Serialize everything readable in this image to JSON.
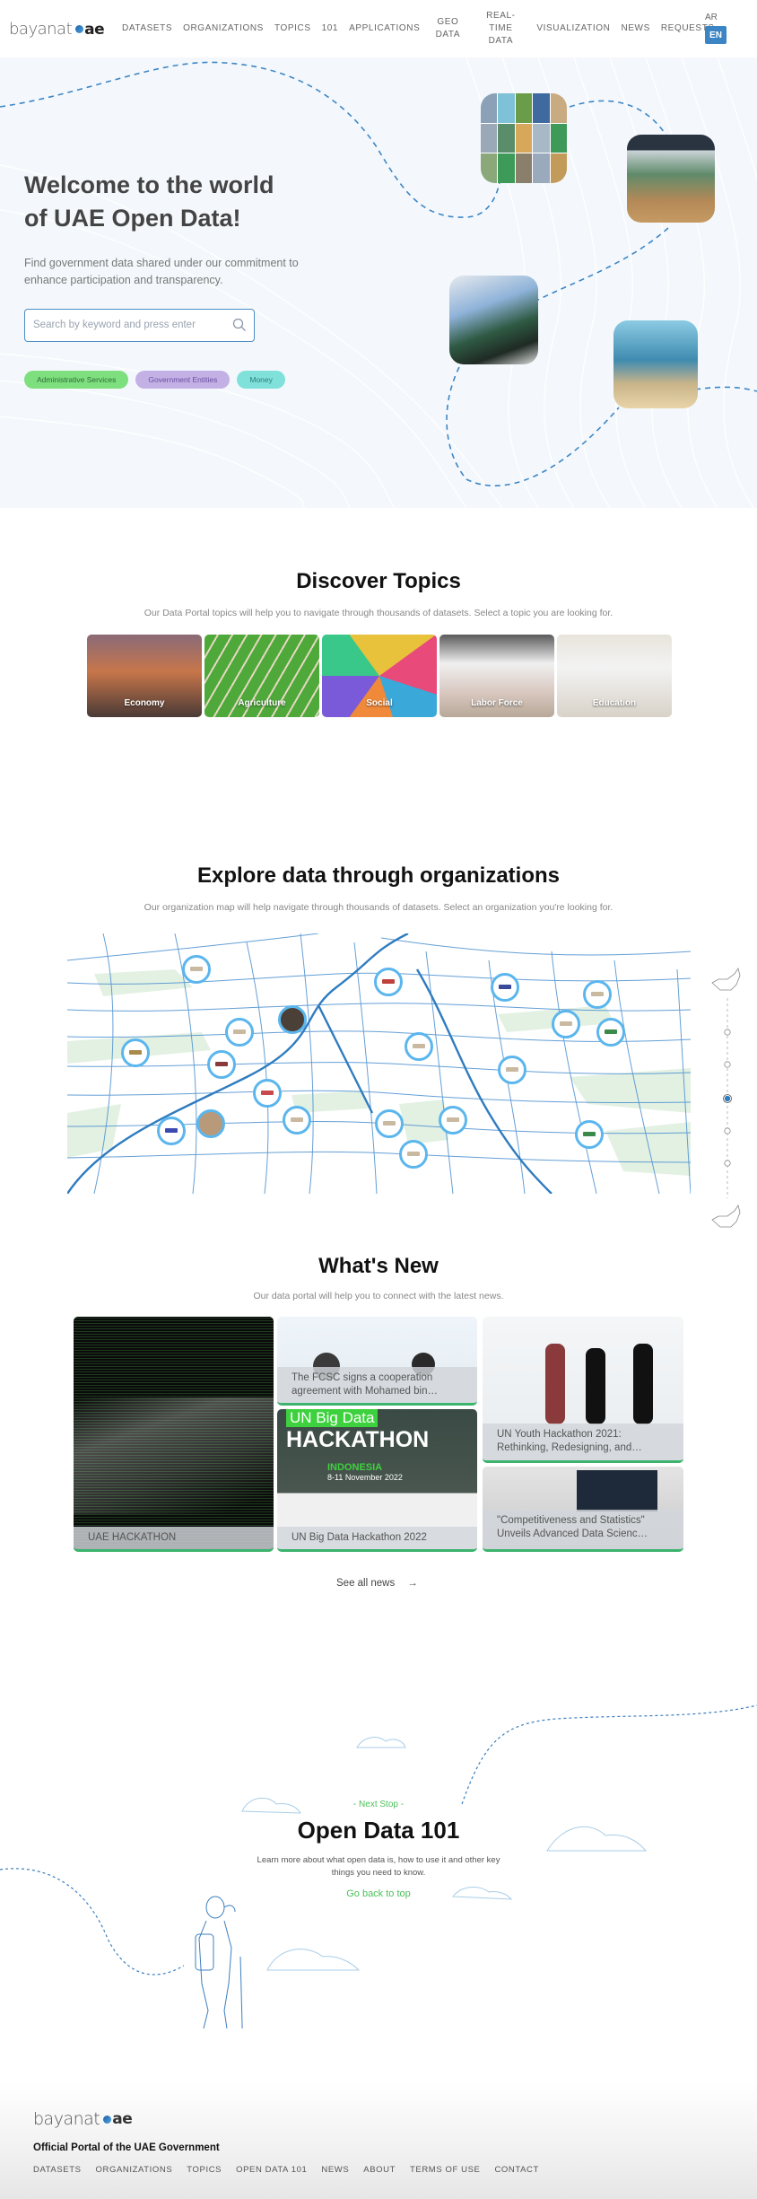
{
  "header": {
    "logo_text": "bayanat",
    "logo_suffix": "ae",
    "nav": [
      {
        "label": "DATASETS"
      },
      {
        "label": "ORGANIZATIONS"
      },
      {
        "label": "TOPICS"
      },
      {
        "label": "101"
      },
      {
        "label": "APPLICATIONS"
      },
      {
        "label": "GEO DATA"
      },
      {
        "label": "REAL-TIME DATA"
      },
      {
        "label": "VISUALIZATION"
      },
      {
        "label": "NEWS"
      },
      {
        "label": "REQUESTS"
      }
    ],
    "lang_ar": "AR",
    "lang_en": "EN"
  },
  "hero": {
    "title_line1": "Welcome to the world",
    "title_line2": "of UAE Open Data!",
    "subtitle": "Find government data shared under our commitment to enhance participation and transparency.",
    "search_placeholder": "Search by keyword and press enter",
    "chips": [
      {
        "label": "Administrative Services",
        "color": "#7edf7e"
      },
      {
        "label": "Government Entities",
        "color": "#c3b1e6"
      },
      {
        "label": "Money",
        "color": "#7fe1da"
      }
    ]
  },
  "topics": {
    "title": "Discover Topics",
    "subtitle": "Our Data Portal topics will help you to navigate through thousands of datasets. Select a topic you are looking for.",
    "items": [
      {
        "label": "Economy"
      },
      {
        "label": "Agriculture"
      },
      {
        "label": "Social"
      },
      {
        "label": "Labor Force"
      },
      {
        "label": "Education"
      }
    ]
  },
  "organizations": {
    "title": "Explore data through organizations",
    "subtitle": "Our organization map will help navigate through thousands of datasets. Select an organization you're looking for.",
    "slider_steps": 5,
    "slider_active_step": 3
  },
  "news": {
    "title": "What's New",
    "subtitle": "Our data portal will help you to connect with the latest news.",
    "items": [
      {
        "caption": "UAE HACKATHON"
      },
      {
        "caption": "The FCSC signs a cooperation agreement with Mohamed bin…"
      },
      {
        "caption": "UN Big Data Hackathon 2022",
        "banner_top": "UN Big Data",
        "banner_main": "HACKATHON",
        "banner_place": "INDONESIA",
        "banner_date": "8-11 November 2022"
      },
      {
        "caption": "UN Youth Hackathon 2021: Rethinking, Redesigning, and…"
      },
      {
        "caption": "\"Competitiveness and Statistics\" Unveils Advanced Data Scienc…"
      }
    ],
    "see_all": "See all news",
    "see_all_icon": "→"
  },
  "open_data": {
    "kicker": "- Next Stop -",
    "title": "Open Data 101",
    "subtitle": "Learn more about what open data is, how to use it and other key things you need to know.",
    "link": "Go back to top"
  },
  "footer": {
    "logo_text": "bayanat",
    "logo_suffix": "ae",
    "tagline": "Official Portal of the UAE Government",
    "links": [
      {
        "label": "DATASETS"
      },
      {
        "label": "ORGANIZATIONS"
      },
      {
        "label": "TOPICS"
      },
      {
        "label": "OPEN DATA 101"
      },
      {
        "label": "NEWS"
      },
      {
        "label": "ABOUT"
      },
      {
        "label": "TERMS OF USE"
      },
      {
        "label": "CONTACT"
      }
    ]
  },
  "colors": {
    "accent_blue": "#3b85c4",
    "accent_green": "#4cbf5a",
    "news_border": "#3cb46e",
    "org_ring": "#5bb6ee"
  }
}
